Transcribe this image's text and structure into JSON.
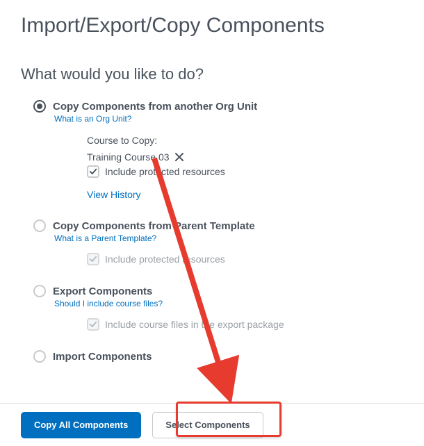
{
  "page": {
    "title": "Import/Export/Copy Components",
    "subtitle": "What would you like to do?"
  },
  "options": {
    "copy_org": {
      "label": "Copy Components from another Org Unit",
      "help": "What is an Org Unit?",
      "course_to_copy_label": "Course to Copy:",
      "course_name": "Training Course 03",
      "include_protected": "Include protected resources",
      "view_history": "View History"
    },
    "copy_parent": {
      "label": "Copy Components from Parent Template",
      "help": "What is a Parent Template?",
      "include_protected": "Include protected resources"
    },
    "export": {
      "label": "Export Components",
      "help": "Should I include course files?",
      "include_files": "Include course files in the export package"
    },
    "import": {
      "label": "Import Components"
    }
  },
  "footer": {
    "copy_all": "Copy All Components",
    "select": "Select Components"
  }
}
